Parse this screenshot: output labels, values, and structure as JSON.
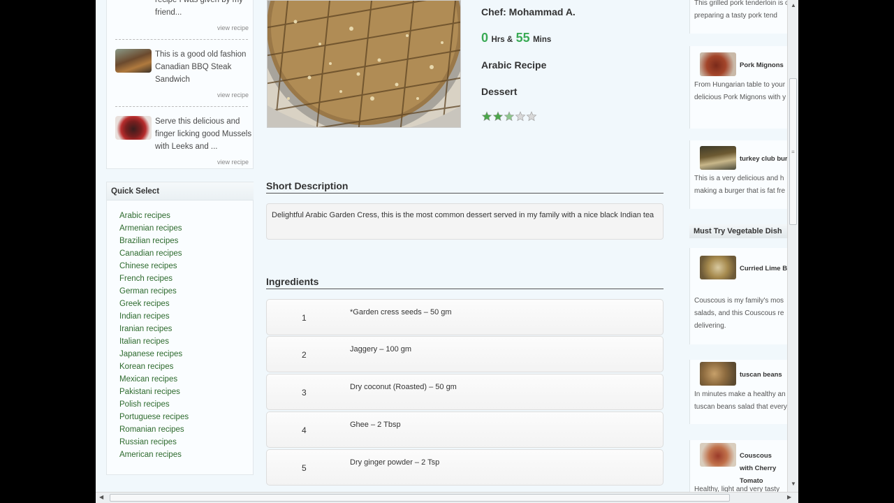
{
  "related": {
    "items": [
      {
        "text": "recipe I was given by my friend...",
        "link": "view recipe"
      },
      {
        "text": "This is a good old fashion Canadian BBQ Steak Sandwich",
        "link": "view recipe"
      },
      {
        "text": "Serve this delicious and finger licking good Mussels with Leeks and ...",
        "link": "view recipe"
      }
    ]
  },
  "quick_select": {
    "title": "Quick Select",
    "items": [
      "Arabic recipes",
      "Armenian recipes",
      "Brazilian recipes",
      "Canadian recipes",
      "Chinese recipes",
      "French recipes",
      "German recipes",
      "Greek recipes",
      "Indian recipes",
      "Iranian recipes",
      "Italian recipes",
      "Japanese recipes",
      "Korean recipes",
      "Mexican recipes",
      "Pakistani recipes",
      "Polish recipes",
      "Portuguese recipes",
      "Romanian recipes",
      "Russian recipes",
      "American recipes"
    ]
  },
  "recipe": {
    "chef": "Chef: Mohammad A.",
    "hours": "0",
    "hours_label": "Hrs &",
    "mins": "55",
    "mins_label": "Mins",
    "cuisine": "Arabic Recipe",
    "category": "Dessert",
    "rating": 2.5,
    "rating_max": 5,
    "short_desc_heading": "Short Description",
    "short_desc": "Delightful Arabic Garden Cress, this is the most common dessert served in my family with a nice black Indian tea",
    "ingredients_heading": "Ingredients",
    "ingredients": [
      {
        "num": "1",
        "text": "*Garden cress seeds – 50 gm"
      },
      {
        "num": "2",
        "text": "Jaggery – 100 gm"
      },
      {
        "num": "3",
        "text": "Dry coconut (Roasted) – 50 gm"
      },
      {
        "num": "4",
        "text": "Ghee – 2 Tbsp"
      },
      {
        "num": "5",
        "text": "Dry ginger powder – 2 Tsp"
      }
    ]
  },
  "right": {
    "top_text": "This grilled pork tenderloin is of preparing a tasty pork tend",
    "cards": [
      {
        "title": "Pork Mignons",
        "text": "From Hungarian table to your delicious Pork Mignons with y ones"
      },
      {
        "title": "turkey club burg",
        "text": "This is a very delicious and h making a burger that is fat fre"
      }
    ],
    "heading": "Must Try Vegetable Dish",
    "veg_cards": [
      {
        "title": "Curried Lime Be tene",
        "text": "Couscous is my family's mos salads, and this Couscous re delivering."
      },
      {
        "title": "tuscan beans",
        "text": "In minutes make a healthy an tuscan beans salad that every"
      },
      {
        "title": "Couscous with Cherry Tomato",
        "text": "Healthy, light and very tasty"
      }
    ]
  },
  "colors": {
    "accent_green": "#3aaa55",
    "link_green": "#2d6a2d",
    "page_bg": "#f1f8fc"
  }
}
